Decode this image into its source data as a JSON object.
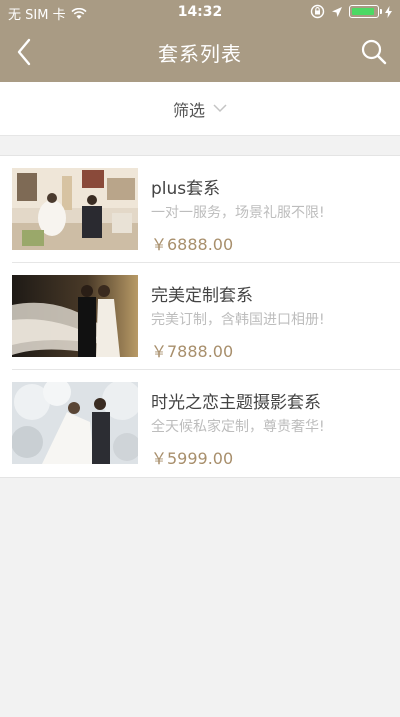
{
  "status": {
    "carrier": "无 SIM 卡",
    "time": "14:32"
  },
  "nav": {
    "title": "套系列表",
    "back_icon": "chevron-left-icon",
    "search_icon": "search-icon"
  },
  "filter": {
    "label": "筛选"
  },
  "packages": [
    {
      "title": "plus套系",
      "subtitle": "一对一服务，场景礼服不限!",
      "price": "￥6888.00"
    },
    {
      "title": "完美定制套系",
      "subtitle": "完美订制，含韩国进口相册!",
      "price": "￥7888.00"
    },
    {
      "title": "时光之恋主题摄影套系",
      "subtitle": "全天候私家定制，尊贵奢华!",
      "price": "￥5999.00"
    }
  ],
  "colors": {
    "header": "#a99b84",
    "price": "#a88f6c",
    "battery": "#4cd964"
  }
}
